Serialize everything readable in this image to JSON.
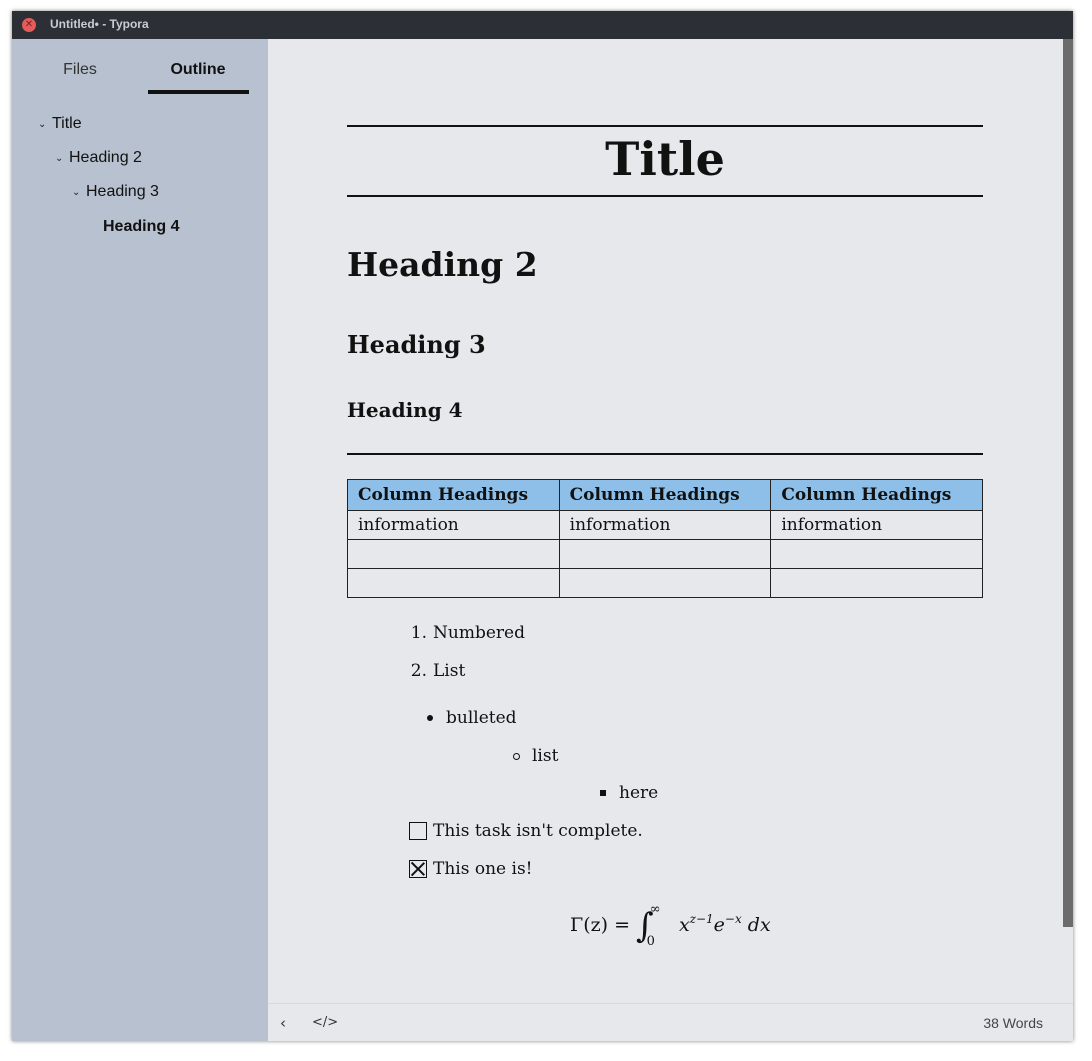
{
  "window": {
    "title": "Untitled• - Typora",
    "close_glyph": "✕"
  },
  "sidebar": {
    "tabs": [
      {
        "label": "Files"
      },
      {
        "label": "Outline",
        "active": true
      }
    ],
    "outline": [
      {
        "label": "Title",
        "chevron": "⌄"
      },
      {
        "label": "Heading 2",
        "chevron": "⌄"
      },
      {
        "label": "Heading 3",
        "chevron": "⌄"
      },
      {
        "label": "Heading 4",
        "chevron": ""
      }
    ]
  },
  "document": {
    "title": "Title",
    "h2": "Heading 2",
    "h3": "Heading 3",
    "h4": "Heading 4",
    "table": {
      "headers": [
        "Column Headings",
        "Column Headings",
        "Column Headings"
      ],
      "rows": [
        [
          "information",
          "information",
          "information"
        ],
        [
          "",
          "",
          ""
        ],
        [
          "",
          "",
          ""
        ]
      ]
    },
    "numbered_list": [
      {
        "num": "1.",
        "text": "Numbered"
      },
      {
        "num": "2.",
        "text": "List"
      }
    ],
    "bulleted_list": [
      {
        "text": "bulleted"
      },
      {
        "text": "list"
      },
      {
        "text": "here"
      }
    ],
    "tasks": [
      {
        "text": "This task isn't complete.",
        "checked": false
      },
      {
        "text": "This one is!",
        "checked": true
      }
    ],
    "math": {
      "lhs_gamma": "Γ",
      "lhs_arg": "(z)",
      "eq": "=",
      "integral": "∫",
      "upper": "∞",
      "lower": "0",
      "x": "x",
      "x_exp": "z−1",
      "e": "e",
      "e_exp": "−x",
      "dx": "dx"
    }
  },
  "footer": {
    "back_icon": "‹",
    "code_icon": "</>",
    "word_count": "38 Words"
  },
  "colors": {
    "sidebar": "#b8c1cf",
    "editor": "#e7e8eb",
    "table_header": "#8dbfe8",
    "titlebar": "#2c2f36"
  }
}
